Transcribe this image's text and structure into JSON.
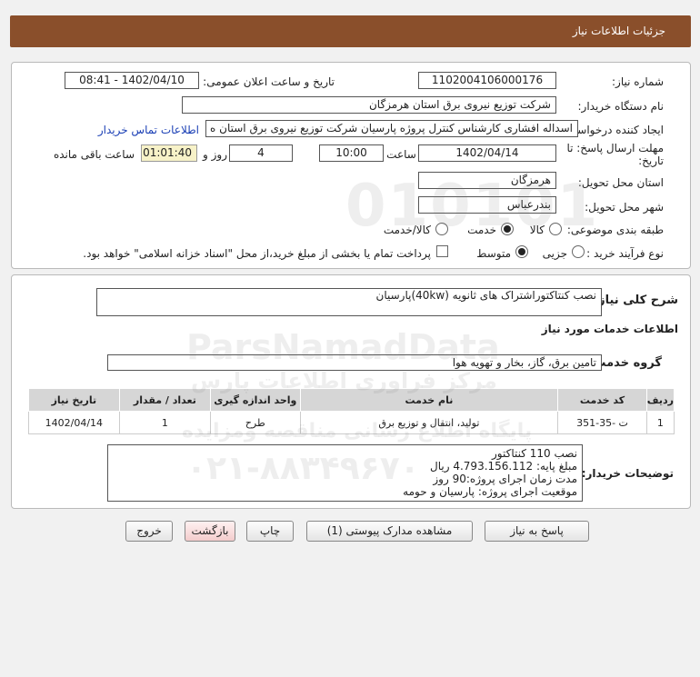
{
  "header": {
    "title": "جزئیات اطلاعات نیاز"
  },
  "info": {
    "need_number_label": "شماره نیاز:",
    "need_number": "1102004106000176",
    "announce_label": "تاریخ و ساعت اعلان عمومی:",
    "announce_value": "1402/04/10 - 08:41",
    "buyer_label": "نام دستگاه خریدار:",
    "buyer_value": "شرکت توزیع نیروی برق استان هرمزگان",
    "creator_label": "ایجاد کننده درخواست:",
    "creator_value": "اسداله افشاری کارشناس کنترل پروژه پارسیان شرکت توزیع نیروی برق استان ه",
    "contact_link": "اطلاعات تماس خریدار",
    "deadline_label": "مهلت ارسال پاسخ: تا",
    "deadline_label2": "تاریخ:",
    "deadline_date": "1402/04/14",
    "time_label": "ساعت",
    "deadline_time": "10:00",
    "days_value": "4",
    "days_label": "روز و",
    "remaining_time": "01:01:40",
    "remaining_label": "ساعت باقی مانده",
    "province_label": "استان محل تحویل:",
    "province_value": "هرمزگان",
    "city_label": "شهر محل تحویل:",
    "city_value": "بندرعباس",
    "category_label": "طبقه بندی موضوعی:",
    "category_options": [
      "کالا",
      "خدمت",
      "کالا/خدمت"
    ],
    "process_label": "نوع فرآیند خرید :",
    "process_options": [
      "جزیی",
      "متوسط"
    ],
    "payment_note": "پرداخت تمام یا بخشی از مبلغ خرید،از محل \"اسناد خزانه اسلامی\" خواهد بود."
  },
  "detail": {
    "summary_label": "شرح کلی نیاز:",
    "summary_value": "نصب کنتاکتوراشتراک های ثانویه (40kw)پارسیان",
    "services_title": "اطلاعات خدمات مورد نیاز",
    "group_label": "گروه خدمت:",
    "group_value": "تامین برق، گاز، بخار و تهویه هوا",
    "table_headers": [
      "ردیف",
      "کد خدمت",
      "نام خدمت",
      "واحد اندازه گیری",
      "تعداد / مقدار",
      "تاریخ نیاز"
    ],
    "table_rows": [
      [
        "1",
        "ت -35-351",
        "تولید، انتقال و توزیع برق",
        "طرح",
        "1",
        "1402/04/14"
      ]
    ],
    "buyer_desc_label": "توضیحات خریدار:",
    "buyer_desc": "نصب 110 کنتاکتور\nمبلغ پایه: 4.793.156.112 ریال\nمدت زمان اجرای پروژه:90 روز\nموقعیت اجرای پروژه: پارسیان و حومه"
  },
  "buttons": {
    "reply": "پاسخ به نیاز",
    "view_docs": "مشاهده مدارک پیوستی (1)",
    "print": "چاپ",
    "back": "بازگشت",
    "exit": "خروج"
  },
  "watermark": {
    "number": "010101",
    "brand": "ParsNamadData",
    "line1": "مرکز فراوری اطلاعات پارس",
    "line2": "پایگاه اطلاع رسانی مناقصه ومزایده",
    "phone": "۰۲۱-۸۸۳۴۹۶۷۰"
  }
}
